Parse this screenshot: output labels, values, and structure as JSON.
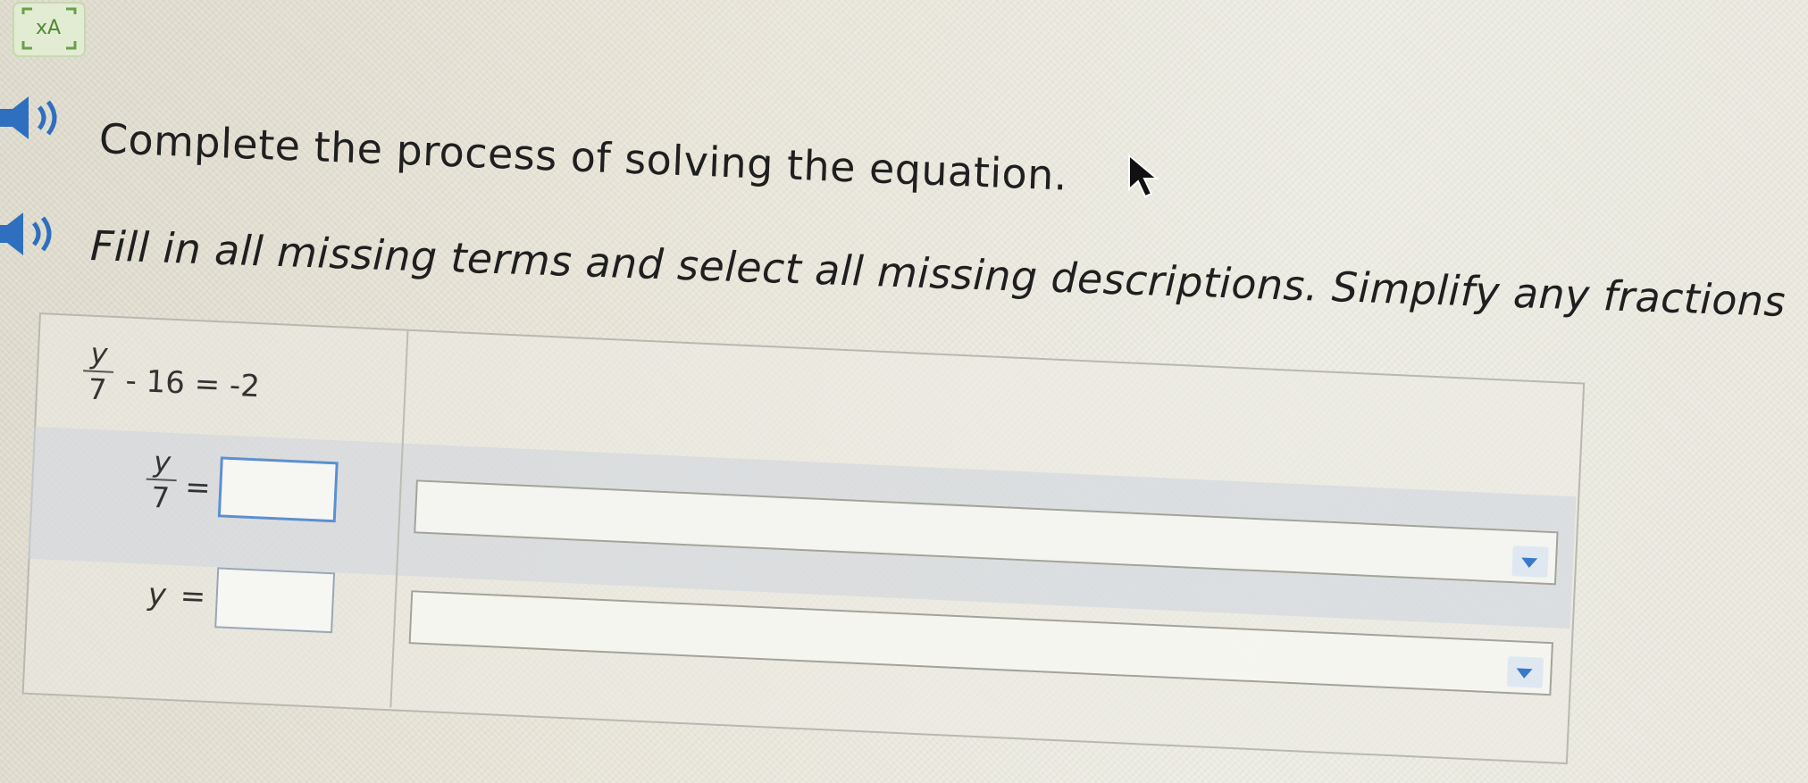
{
  "header": {
    "logo_icon": "translate-icon",
    "logo_text": "xA"
  },
  "question": {
    "prompt": "Complete the process of solving the equation.",
    "instructions": "Fill in all missing terms and select all missing descriptions. Simplify any fractions"
  },
  "steps": [
    {
      "fraction_numerator": "y",
      "fraction_denominator": "7",
      "tail": "- 16 = -2"
    },
    {
      "fraction_numerator": "y",
      "fraction_denominator": "7",
      "equals": "=",
      "answer_value": "",
      "description_selected": ""
    },
    {
      "lhs": "y",
      "equals": "=",
      "answer_value": "",
      "description_selected": ""
    }
  ],
  "colors": {
    "accent": "#3a78c9",
    "active_border": "#5c8fd0"
  }
}
